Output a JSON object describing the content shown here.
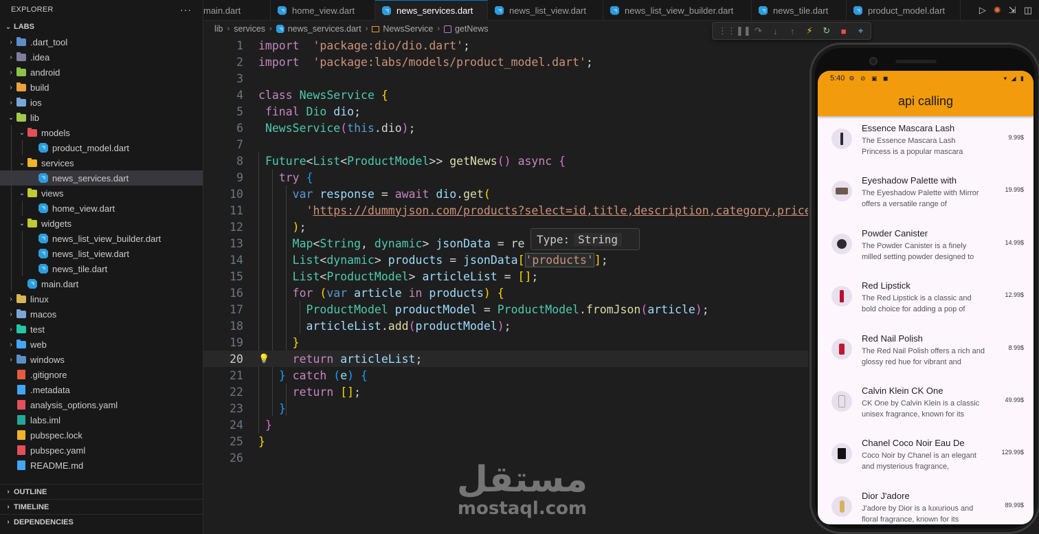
{
  "explorer": {
    "title": "EXPLORER",
    "more": "···",
    "root": "LABS",
    "items": [
      {
        "label": ".dart_tool",
        "kind": "folder",
        "depth": 0,
        "chev": "›",
        "color": "#5d8ec9"
      },
      {
        "label": ".idea",
        "kind": "folder",
        "depth": 0,
        "chev": "›",
        "color": "#7d7d9c"
      },
      {
        "label": "android",
        "kind": "folder",
        "depth": 0,
        "chev": "›",
        "color": "#8bc34a"
      },
      {
        "label": "build",
        "kind": "folder",
        "depth": 0,
        "chev": "›",
        "color": "#e8a33d"
      },
      {
        "label": "ios",
        "kind": "folder",
        "depth": 0,
        "chev": "›",
        "color": "#7ba7d8"
      },
      {
        "label": "lib",
        "kind": "folder",
        "depth": 0,
        "chev": "⌄",
        "color": "#a3c94a"
      },
      {
        "label": "models",
        "kind": "folder",
        "depth": 1,
        "chev": "⌄",
        "color": "#e2505a"
      },
      {
        "label": "product_model.dart",
        "kind": "dart",
        "depth": 2,
        "chev": ""
      },
      {
        "label": "services",
        "kind": "folder",
        "depth": 1,
        "chev": "⌄",
        "color": "#f0b429"
      },
      {
        "label": "news_services.dart",
        "kind": "dart",
        "depth": 2,
        "chev": "",
        "selected": true
      },
      {
        "label": "views",
        "kind": "folder",
        "depth": 1,
        "chev": "⌄",
        "color": "#c0ca33"
      },
      {
        "label": "home_view.dart",
        "kind": "dart",
        "depth": 2,
        "chev": ""
      },
      {
        "label": "widgets",
        "kind": "folder",
        "depth": 1,
        "chev": "⌄",
        "color": "#c0ca33"
      },
      {
        "label": "news_list_view_builder.dart",
        "kind": "dart",
        "depth": 2,
        "chev": ""
      },
      {
        "label": "news_list_view.dart",
        "kind": "dart",
        "depth": 2,
        "chev": ""
      },
      {
        "label": "news_tile.dart",
        "kind": "dart",
        "depth": 2,
        "chev": ""
      },
      {
        "label": "main.dart",
        "kind": "dart",
        "depth": 1,
        "chev": ""
      },
      {
        "label": "linux",
        "kind": "folder",
        "depth": 0,
        "chev": "›",
        "color": "#d6b656"
      },
      {
        "label": "macos",
        "kind": "folder",
        "depth": 0,
        "chev": "›",
        "color": "#7ba7d8"
      },
      {
        "label": "test",
        "kind": "folder",
        "depth": 0,
        "chev": "›",
        "color": "#26c6a5"
      },
      {
        "label": "web",
        "kind": "folder",
        "depth": 0,
        "chev": "›",
        "color": "#42a5f5"
      },
      {
        "label": "windows",
        "kind": "folder",
        "depth": 0,
        "chev": "›",
        "color": "#5d8ec9"
      },
      {
        "label": ".gitignore",
        "kind": "file",
        "depth": 0,
        "chev": "",
        "color": "#e55b3c"
      },
      {
        "label": ".metadata",
        "kind": "file",
        "depth": 0,
        "chev": "",
        "color": "#42a5f5"
      },
      {
        "label": "analysis_options.yaml",
        "kind": "file",
        "depth": 0,
        "chev": "",
        "color": "#e2505a"
      },
      {
        "label": "labs.iml",
        "kind": "file",
        "depth": 0,
        "chev": "",
        "color": "#26a69a"
      },
      {
        "label": "pubspec.lock",
        "kind": "file",
        "depth": 0,
        "chev": "",
        "color": "#f0b429"
      },
      {
        "label": "pubspec.yaml",
        "kind": "file",
        "depth": 0,
        "chev": "",
        "color": "#e2505a"
      },
      {
        "label": "README.md",
        "kind": "file",
        "depth": 0,
        "chev": "",
        "color": "#42a5f5"
      }
    ],
    "panels": [
      "OUTLINE",
      "TIMELINE",
      "DEPENDENCIES"
    ]
  },
  "tabs": [
    {
      "label": "main.dart"
    },
    {
      "label": "home_view.dart"
    },
    {
      "label": "news_services.dart",
      "active": true
    },
    {
      "label": "news_list_view.dart"
    },
    {
      "label": "news_list_view_builder.dart"
    },
    {
      "label": "news_tile.dart"
    },
    {
      "label": "product_model.dart"
    }
  ],
  "tab_actions": {
    "run": "▷",
    "flutter": "✺",
    "split": "⇲",
    "layout": "◫"
  },
  "breadcrumb": {
    "segments": [
      "lib",
      "services",
      "news_services.dart",
      "NewsService",
      "getNews"
    ]
  },
  "debug_toolbar": {
    "icons": [
      "⋮⋮",
      "❚❚",
      "↷",
      "↓",
      "↑",
      "⚡",
      "↻",
      "■",
      "⌖"
    ]
  },
  "editor": {
    "current_line": 20,
    "lines": [
      [
        [
          "kw",
          "import"
        ],
        [
          "",
          "  "
        ],
        [
          "st",
          "'package:dio/dio.dart'"
        ],
        [
          "",
          ";"
        ]
      ],
      [
        [
          "kw",
          "import"
        ],
        [
          "",
          "  "
        ],
        [
          "st",
          "'package:labs/models/product_model.dart'"
        ],
        [
          "",
          ";"
        ]
      ],
      [],
      [
        [
          "kw",
          "class"
        ],
        [
          "",
          " "
        ],
        [
          "ty",
          "NewsService"
        ],
        [
          "",
          " "
        ],
        [
          "br1",
          "{"
        ]
      ],
      [
        [
          "",
          " "
        ],
        [
          "kw",
          "final"
        ],
        [
          "",
          " "
        ],
        [
          "ty",
          "Dio"
        ],
        [
          "",
          " "
        ],
        [
          "vr",
          "dio"
        ],
        [
          "",
          ";"
        ]
      ],
      [
        [
          "",
          " "
        ],
        [
          "ty",
          "NewsService"
        ],
        [
          "br2",
          "("
        ],
        [
          "kb",
          "this"
        ],
        [
          "",
          ".dio"
        ],
        [
          "br2",
          ")"
        ],
        [
          "",
          ";"
        ]
      ],
      [],
      [
        [
          "",
          " "
        ],
        [
          "ty",
          "Future"
        ],
        [
          "",
          "<"
        ],
        [
          "ty",
          "List"
        ],
        [
          "",
          "<"
        ],
        [
          "ty",
          "ProductModel"
        ],
        [
          "",
          ">> "
        ],
        [
          "fn",
          "getNews"
        ],
        [
          "br2",
          "()"
        ],
        [
          "",
          " "
        ],
        [
          "kw",
          "async"
        ],
        [
          "",
          " "
        ],
        [
          "br2",
          "{"
        ]
      ],
      [
        [
          "",
          "   "
        ],
        [
          "kw",
          "try"
        ],
        [
          "",
          " "
        ],
        [
          "br3",
          "{"
        ]
      ],
      [
        [
          "",
          "     "
        ],
        [
          "kb",
          "var"
        ],
        [
          "",
          " "
        ],
        [
          "vr",
          "response"
        ],
        [
          "",
          " = "
        ],
        [
          "kw",
          "await"
        ],
        [
          "",
          " "
        ],
        [
          "vr",
          "dio"
        ],
        [
          "",
          "."
        ],
        [
          "fn",
          "get"
        ],
        [
          "br1",
          "("
        ]
      ],
      [
        [
          "",
          "       "
        ],
        [
          "st",
          "'"
        ],
        [
          "st url",
          "https://dummyjson.com/products?select=id,title,description,category,price"
        ]
      ],
      [
        [
          "",
          "     "
        ],
        [
          "br1",
          ")"
        ],
        [
          "",
          ";"
        ]
      ],
      [
        [
          "",
          "     "
        ],
        [
          "ty",
          "Map"
        ],
        [
          "",
          "<"
        ],
        [
          "ty",
          "String"
        ],
        [
          "",
          ", "
        ],
        [
          "ty",
          "dynamic"
        ],
        [
          "",
          "> "
        ],
        [
          "vr",
          "jsonData"
        ],
        [
          "",
          " = re"
        ]
      ],
      [
        [
          "",
          "     "
        ],
        [
          "ty",
          "List"
        ],
        [
          "",
          "<"
        ],
        [
          "ty",
          "dynamic"
        ],
        [
          "",
          "> "
        ],
        [
          "vr",
          "products"
        ],
        [
          "",
          " = "
        ],
        [
          "vr",
          "jsonData"
        ],
        [
          "br1",
          "["
        ],
        [
          "st hl",
          "'products'"
        ],
        [
          "br1",
          "]"
        ],
        [
          "",
          ";"
        ]
      ],
      [
        [
          "",
          "     "
        ],
        [
          "ty",
          "List"
        ],
        [
          "",
          "<"
        ],
        [
          "ty",
          "ProductModel"
        ],
        [
          "",
          "> "
        ],
        [
          "vr",
          "articleList"
        ],
        [
          "",
          " = "
        ],
        [
          "br1",
          "[]"
        ],
        [
          "",
          ";"
        ]
      ],
      [
        [
          "",
          "     "
        ],
        [
          "kw",
          "for"
        ],
        [
          "",
          " "
        ],
        [
          "br1",
          "("
        ],
        [
          "kb",
          "var"
        ],
        [
          "",
          " "
        ],
        [
          "vr",
          "article"
        ],
        [
          "",
          " "
        ],
        [
          "kw",
          "in"
        ],
        [
          "",
          " "
        ],
        [
          "vr",
          "products"
        ],
        [
          "br1",
          ")"
        ],
        [
          "",
          " "
        ],
        [
          "br1",
          "{"
        ]
      ],
      [
        [
          "",
          "       "
        ],
        [
          "ty",
          "ProductModel"
        ],
        [
          "",
          " "
        ],
        [
          "vr",
          "productModel"
        ],
        [
          "",
          " = "
        ],
        [
          "ty",
          "ProductModel"
        ],
        [
          "",
          "."
        ],
        [
          "fn",
          "fromJson"
        ],
        [
          "br2",
          "("
        ],
        [
          "vr",
          "article"
        ],
        [
          "br2",
          ")"
        ],
        [
          "",
          ";"
        ]
      ],
      [
        [
          "",
          "       "
        ],
        [
          "vr",
          "articleList"
        ],
        [
          "",
          "."
        ],
        [
          "fn",
          "add"
        ],
        [
          "br2",
          "("
        ],
        [
          "vr",
          "productModel"
        ],
        [
          "br2",
          ")"
        ],
        [
          "",
          ";"
        ]
      ],
      [
        [
          "",
          "     "
        ],
        [
          "br1",
          "}"
        ]
      ],
      [
        [
          "",
          "     "
        ],
        [
          "kw",
          "return"
        ],
        [
          "",
          " "
        ],
        [
          "vr",
          "articleList"
        ],
        [
          "",
          ";"
        ]
      ],
      [
        [
          "",
          "   "
        ],
        [
          "br3",
          "}"
        ],
        [
          "",
          " "
        ],
        [
          "kw",
          "catch"
        ],
        [
          "",
          " "
        ],
        [
          "br3",
          "("
        ],
        [
          "vr",
          "e"
        ],
        [
          "br3",
          ")"
        ],
        [
          "",
          " "
        ],
        [
          "br3",
          "{"
        ]
      ],
      [
        [
          "",
          "     "
        ],
        [
          "kw",
          "return"
        ],
        [
          "",
          " "
        ],
        [
          "br1",
          "[]"
        ],
        [
          "",
          ";"
        ]
      ],
      [
        [
          "",
          "   "
        ],
        [
          "br3",
          "}"
        ]
      ],
      [
        [
          "",
          " "
        ],
        [
          "br2",
          "}"
        ]
      ],
      [
        [
          "br1",
          "}"
        ]
      ],
      []
    ]
  },
  "tooltip": {
    "label": "Type:",
    "value": "String"
  },
  "watermark": {
    "arabic": "مستقل",
    "latin": "mostaql.com"
  },
  "phone": {
    "time": "5:40",
    "status_left_icons": "⚙ ⊘ ▣ ◼",
    "status_right_icons": "▾ ◢ ▮",
    "app_title": "api calling",
    "products": [
      {
        "title": "Essence Mascara Lash",
        "desc": "The Essence Mascara Lash Princess is a popular mascara",
        "price": "9.99$"
      },
      {
        "title": "Eyeshadow Palette with",
        "desc": "The Eyeshadow Palette with Mirror offers a versatile range of",
        "price": "19.99$"
      },
      {
        "title": "Powder Canister",
        "desc": "The Powder Canister is a finely milled setting powder designed to",
        "price": "14.99$"
      },
      {
        "title": "Red Lipstick",
        "desc": "The Red Lipstick is a classic and bold choice for adding a pop of",
        "price": "12.99$"
      },
      {
        "title": "Red Nail Polish",
        "desc": "The Red Nail Polish offers a rich and glossy red hue for vibrant and",
        "price": "8.99$"
      },
      {
        "title": "Calvin Klein CK One",
        "desc": "CK One by Calvin Klein is a classic unisex fragrance, known for its",
        "price": "49.99$"
      },
      {
        "title": "Chanel Coco Noir Eau De",
        "desc": "Coco Noir by Chanel is an elegant and mysterious fragrance,",
        "price": "129.99$"
      },
      {
        "title": "Dior J'adore",
        "desc": "J'adore by Dior is a luxurious and floral fragrance, known for its",
        "price": "89.99$"
      }
    ]
  }
}
